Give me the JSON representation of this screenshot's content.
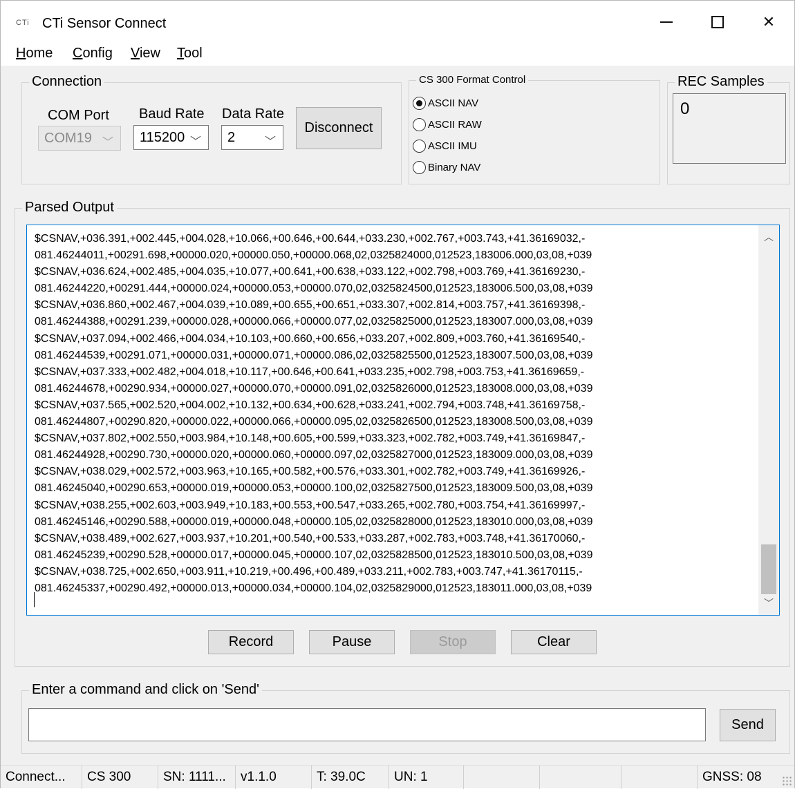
{
  "window": {
    "logo_text": "CTi",
    "title": "CTi Sensor Connect"
  },
  "menu": [
    "Home",
    "Config",
    "View",
    "Tool"
  ],
  "connection": {
    "group_label": "Connection",
    "com_port_label": "COM Port",
    "com_port_value": "COM19",
    "baud_rate_label": "Baud Rate",
    "baud_rate_value": "115200",
    "data_rate_label": "Data Rate",
    "data_rate_value": "2",
    "disconnect_label": "Disconnect"
  },
  "format_control": {
    "group_label": "CS 300 Format Control",
    "options": [
      "ASCII NAV",
      "ASCII RAW",
      "ASCII IMU",
      "Binary NAV"
    ],
    "selected": "ASCII NAV"
  },
  "rec_samples": {
    "group_label": "REC Samples",
    "value": "0"
  },
  "parsed_output": {
    "group_label": "Parsed Output",
    "lines": [
      "$CSNAV,+036.391,+002.445,+004.028,+10.066,+00.646,+00.644,+033.230,+002.767,+003.743,+41.36169032,-",
      "081.46244011,+00291.698,+00000.020,+00000.050,+00000.068,02,0325824000,012523,183006.000,03,08,+039",
      "$CSNAV,+036.624,+002.485,+004.035,+10.077,+00.641,+00.638,+033.122,+002.798,+003.769,+41.36169230,-",
      "081.46244220,+00291.444,+00000.024,+00000.053,+00000.070,02,0325824500,012523,183006.500,03,08,+039",
      "$CSNAV,+036.860,+002.467,+004.039,+10.089,+00.655,+00.651,+033.307,+002.814,+003.757,+41.36169398,-",
      "081.46244388,+00291.239,+00000.028,+00000.066,+00000.077,02,0325825000,012523,183007.000,03,08,+039",
      "$CSNAV,+037.094,+002.466,+004.034,+10.103,+00.660,+00.656,+033.207,+002.809,+003.760,+41.36169540,-",
      "081.46244539,+00291.071,+00000.031,+00000.071,+00000.086,02,0325825500,012523,183007.500,03,08,+039",
      "$CSNAV,+037.333,+002.482,+004.018,+10.117,+00.646,+00.641,+033.235,+002.798,+003.753,+41.36169659,-",
      "081.46244678,+00290.934,+00000.027,+00000.070,+00000.091,02,0325826000,012523,183008.000,03,08,+039",
      "$CSNAV,+037.565,+002.520,+004.002,+10.132,+00.634,+00.628,+033.241,+002.794,+003.748,+41.36169758,-",
      "081.46244807,+00290.820,+00000.022,+00000.066,+00000.095,02,0325826500,012523,183008.500,03,08,+039",
      "$CSNAV,+037.802,+002.550,+003.984,+10.148,+00.605,+00.599,+033.323,+002.782,+003.749,+41.36169847,-",
      "081.46244928,+00290.730,+00000.020,+00000.060,+00000.097,02,0325827000,012523,183009.000,03,08,+039",
      "$CSNAV,+038.029,+002.572,+003.963,+10.165,+00.582,+00.576,+033.301,+002.782,+003.749,+41.36169926,-",
      "081.46245040,+00290.653,+00000.019,+00000.053,+00000.100,02,0325827500,012523,183009.500,03,08,+039",
      "$CSNAV,+038.255,+002.603,+003.949,+10.183,+00.553,+00.547,+033.265,+002.780,+003.754,+41.36169997,-",
      "081.46245146,+00290.588,+00000.019,+00000.048,+00000.105,02,0325828000,012523,183010.000,03,08,+039",
      "$CSNAV,+038.489,+002.627,+003.937,+10.201,+00.540,+00.533,+033.287,+002.783,+003.748,+41.36170060,-",
      "081.46245239,+00290.528,+00000.017,+00000.045,+00000.107,02,0325828500,012523,183010.500,03,08,+039",
      "$CSNAV,+038.725,+002.650,+003.911,+10.219,+00.496,+00.489,+033.211,+002.783,+003.747,+41.36170115,-",
      "081.46245337,+00290.492,+00000.013,+00000.034,+00000.104,02,0325829000,012523,183011.000,03,08,+039"
    ]
  },
  "controls": {
    "record": "Record",
    "pause": "Pause",
    "stop": "Stop",
    "clear": "Clear"
  },
  "command": {
    "group_label": "Enter a command and click on 'Send'",
    "value": "",
    "send_label": "Send"
  },
  "status_bar": {
    "connection": "Connect...",
    "model": "CS 300",
    "serial": "SN: 1111...",
    "version": "v1.1.0",
    "temperature": "T: 39.0C",
    "un": "UN: 1",
    "gnss": "GNSS: 08"
  }
}
